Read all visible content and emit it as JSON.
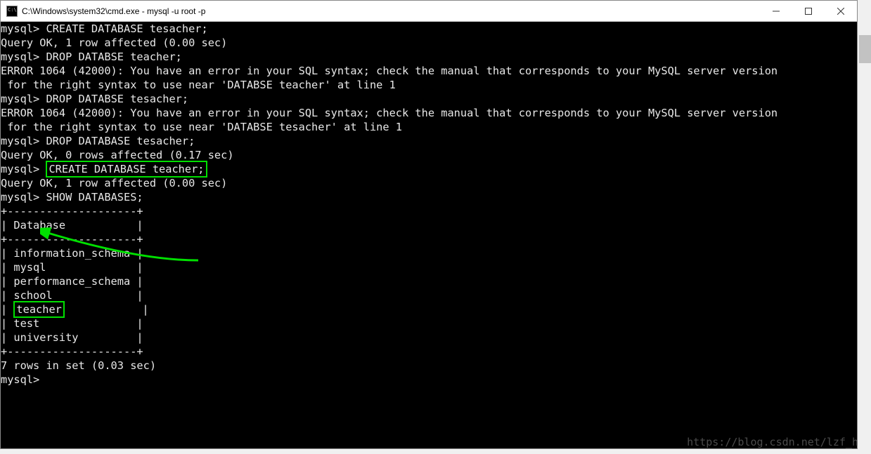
{
  "window": {
    "title": "C:\\Windows\\system32\\cmd.exe - mysql  -u root -p"
  },
  "terminal": {
    "prompt": "mysql> ",
    "lines": [
      {
        "t": "CREATE DATABASE tesacher;",
        "p": true
      },
      {
        "t": "Query OK, 1 row affected (0.00 sec)"
      },
      {
        "t": ""
      },
      {
        "t": "DROP DATABSE teacher;",
        "p": true
      },
      {
        "t": "ERROR 1064 (42000): You have an error in your SQL syntax; check the manual that corresponds to your MySQL server version"
      },
      {
        "t": " for the right syntax to use near 'DATABSE teacher' at line 1"
      },
      {
        "t": "DROP DATABSE tesacher;",
        "p": true
      },
      {
        "t": "ERROR 1064 (42000): You have an error in your SQL syntax; check the manual that corresponds to your MySQL server version"
      },
      {
        "t": " for the right syntax to use near 'DATABSE tesacher' at line 1"
      },
      {
        "t": "DROP DATABASE tesacher;",
        "p": true
      },
      {
        "t": "Query OK, 0 rows affected (0.17 sec)"
      },
      {
        "t": ""
      },
      {
        "t": "CREATE DATABASE teacher;",
        "p": true,
        "hl": true
      },
      {
        "t": "Query OK, 1 row affected (0.00 sec)"
      },
      {
        "t": ""
      },
      {
        "t": "SHOW DATABASES;",
        "p": true
      }
    ],
    "table": {
      "border_top": "+--------------------+",
      "header_row": "| Database           |",
      "border_mid": "+--------------------+",
      "rows": [
        "| information_schema |",
        "| mysql              |",
        "| performance_schema |",
        "| school             |"
      ],
      "highlighted_row": "| teacher            |",
      "rows_after": [
        "| test               |",
        "| university         |"
      ],
      "border_bot": "+--------------------+",
      "footer": "7 rows in set (0.03 sec)"
    },
    "final_prompt": "mysql> "
  },
  "watermark": "https://blog.csdn.net/lzf_h",
  "colors": {
    "highlight": "#00e000",
    "term_bg": "#000000",
    "term_fg": "#c0c0c0"
  }
}
